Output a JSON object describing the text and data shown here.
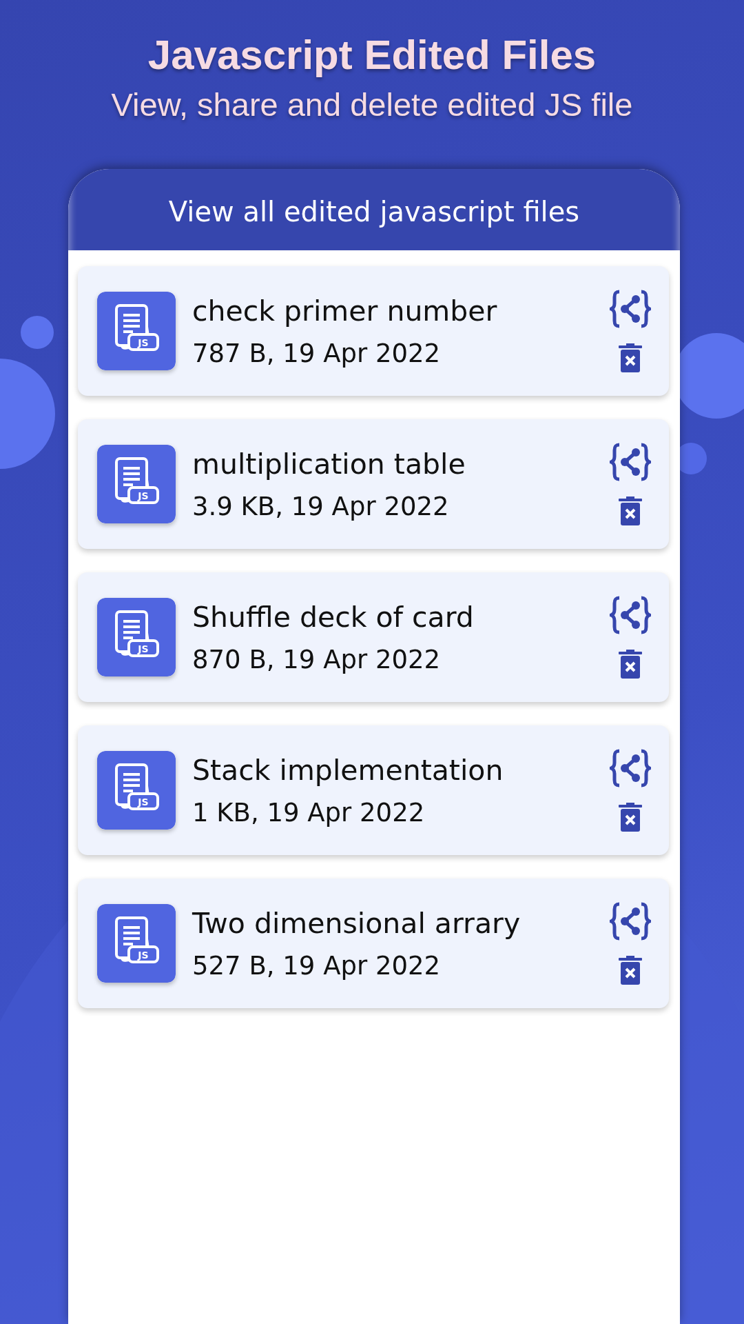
{
  "header": {
    "title": "Javascript Edited Files",
    "subtitle": "View, share and delete edited JS file"
  },
  "screen": {
    "title": "View all edited javascript files"
  },
  "files": [
    {
      "icon_label": "JS",
      "name": "check primer number",
      "details": "787 B, 19 Apr 2022"
    },
    {
      "icon_label": "JS",
      "name": "multiplication table",
      "details": "3.9 KB, 19 Apr 2022"
    },
    {
      "icon_label": "JS",
      "name": "Shuffle deck of card",
      "details": "870 B, 19 Apr 2022"
    },
    {
      "icon_label": "JS",
      "name": "Stack implementation",
      "details": "1 KB, 19 Apr 2022"
    },
    {
      "icon_label": "JS",
      "name": "Two dimensional arrary",
      "details": "527 B, 19 Apr 2022"
    }
  ]
}
